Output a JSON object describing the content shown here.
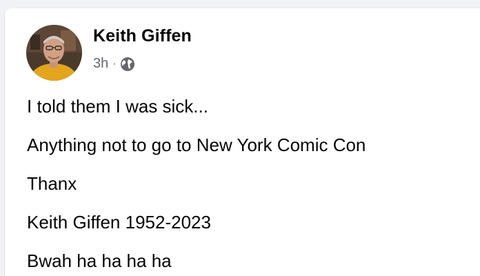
{
  "post": {
    "author": "Keith Giffen",
    "timestamp": "3h",
    "separator": "·",
    "audience_icon": "globe-icon",
    "lines": [
      "I told them I was sick...",
      "Anything not to go to New York Comic Con",
      "Thanx",
      "Keith Giffen 1952-2023",
      "Bwah ha ha ha ha"
    ]
  },
  "colors": {
    "page_bg": "#f0f2f5",
    "card_bg": "#ffffff",
    "primary_text": "#050505",
    "secondary_text": "#65676b"
  }
}
